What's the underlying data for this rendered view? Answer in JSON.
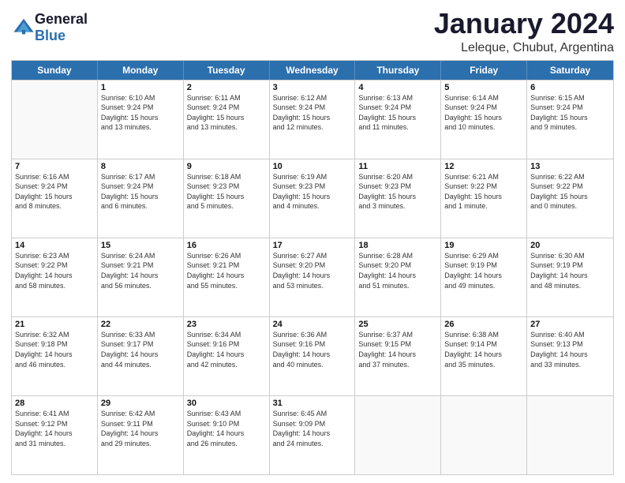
{
  "logo": {
    "text_general": "General",
    "text_blue": "Blue"
  },
  "header": {
    "month": "January 2024",
    "location": "Leleque, Chubut, Argentina"
  },
  "weekdays": [
    "Sunday",
    "Monday",
    "Tuesday",
    "Wednesday",
    "Thursday",
    "Friday",
    "Saturday"
  ],
  "rows": [
    [
      {
        "day": "",
        "lines": [],
        "empty": true
      },
      {
        "day": "1",
        "lines": [
          "Sunrise: 6:10 AM",
          "Sunset: 9:24 PM",
          "Daylight: 15 hours",
          "and 13 minutes."
        ],
        "empty": false
      },
      {
        "day": "2",
        "lines": [
          "Sunrise: 6:11 AM",
          "Sunset: 9:24 PM",
          "Daylight: 15 hours",
          "and 13 minutes."
        ],
        "empty": false
      },
      {
        "day": "3",
        "lines": [
          "Sunrise: 6:12 AM",
          "Sunset: 9:24 PM",
          "Daylight: 15 hours",
          "and 12 minutes."
        ],
        "empty": false
      },
      {
        "day": "4",
        "lines": [
          "Sunrise: 6:13 AM",
          "Sunset: 9:24 PM",
          "Daylight: 15 hours",
          "and 11 minutes."
        ],
        "empty": false
      },
      {
        "day": "5",
        "lines": [
          "Sunrise: 6:14 AM",
          "Sunset: 9:24 PM",
          "Daylight: 15 hours",
          "and 10 minutes."
        ],
        "empty": false
      },
      {
        "day": "6",
        "lines": [
          "Sunrise: 6:15 AM",
          "Sunset: 9:24 PM",
          "Daylight: 15 hours",
          "and 9 minutes."
        ],
        "empty": false
      }
    ],
    [
      {
        "day": "7",
        "lines": [
          "Sunrise: 6:16 AM",
          "Sunset: 9:24 PM",
          "Daylight: 15 hours",
          "and 8 minutes."
        ],
        "empty": false
      },
      {
        "day": "8",
        "lines": [
          "Sunrise: 6:17 AM",
          "Sunset: 9:24 PM",
          "Daylight: 15 hours",
          "and 6 minutes."
        ],
        "empty": false
      },
      {
        "day": "9",
        "lines": [
          "Sunrise: 6:18 AM",
          "Sunset: 9:23 PM",
          "Daylight: 15 hours",
          "and 5 minutes."
        ],
        "empty": false
      },
      {
        "day": "10",
        "lines": [
          "Sunrise: 6:19 AM",
          "Sunset: 9:23 PM",
          "Daylight: 15 hours",
          "and 4 minutes."
        ],
        "empty": false
      },
      {
        "day": "11",
        "lines": [
          "Sunrise: 6:20 AM",
          "Sunset: 9:23 PM",
          "Daylight: 15 hours",
          "and 3 minutes."
        ],
        "empty": false
      },
      {
        "day": "12",
        "lines": [
          "Sunrise: 6:21 AM",
          "Sunset: 9:22 PM",
          "Daylight: 15 hours",
          "and 1 minute."
        ],
        "empty": false
      },
      {
        "day": "13",
        "lines": [
          "Sunrise: 6:22 AM",
          "Sunset: 9:22 PM",
          "Daylight: 15 hours",
          "and 0 minutes."
        ],
        "empty": false
      }
    ],
    [
      {
        "day": "14",
        "lines": [
          "Sunrise: 6:23 AM",
          "Sunset: 9:22 PM",
          "Daylight: 14 hours",
          "and 58 minutes."
        ],
        "empty": false
      },
      {
        "day": "15",
        "lines": [
          "Sunrise: 6:24 AM",
          "Sunset: 9:21 PM",
          "Daylight: 14 hours",
          "and 56 minutes."
        ],
        "empty": false
      },
      {
        "day": "16",
        "lines": [
          "Sunrise: 6:26 AM",
          "Sunset: 9:21 PM",
          "Daylight: 14 hours",
          "and 55 minutes."
        ],
        "empty": false
      },
      {
        "day": "17",
        "lines": [
          "Sunrise: 6:27 AM",
          "Sunset: 9:20 PM",
          "Daylight: 14 hours",
          "and 53 minutes."
        ],
        "empty": false
      },
      {
        "day": "18",
        "lines": [
          "Sunrise: 6:28 AM",
          "Sunset: 9:20 PM",
          "Daylight: 14 hours",
          "and 51 minutes."
        ],
        "empty": false
      },
      {
        "day": "19",
        "lines": [
          "Sunrise: 6:29 AM",
          "Sunset: 9:19 PM",
          "Daylight: 14 hours",
          "and 49 minutes."
        ],
        "empty": false
      },
      {
        "day": "20",
        "lines": [
          "Sunrise: 6:30 AM",
          "Sunset: 9:19 PM",
          "Daylight: 14 hours",
          "and 48 minutes."
        ],
        "empty": false
      }
    ],
    [
      {
        "day": "21",
        "lines": [
          "Sunrise: 6:32 AM",
          "Sunset: 9:18 PM",
          "Daylight: 14 hours",
          "and 46 minutes."
        ],
        "empty": false
      },
      {
        "day": "22",
        "lines": [
          "Sunrise: 6:33 AM",
          "Sunset: 9:17 PM",
          "Daylight: 14 hours",
          "and 44 minutes."
        ],
        "empty": false
      },
      {
        "day": "23",
        "lines": [
          "Sunrise: 6:34 AM",
          "Sunset: 9:16 PM",
          "Daylight: 14 hours",
          "and 42 minutes."
        ],
        "empty": false
      },
      {
        "day": "24",
        "lines": [
          "Sunrise: 6:36 AM",
          "Sunset: 9:16 PM",
          "Daylight: 14 hours",
          "and 40 minutes."
        ],
        "empty": false
      },
      {
        "day": "25",
        "lines": [
          "Sunrise: 6:37 AM",
          "Sunset: 9:15 PM",
          "Daylight: 14 hours",
          "and 37 minutes."
        ],
        "empty": false
      },
      {
        "day": "26",
        "lines": [
          "Sunrise: 6:38 AM",
          "Sunset: 9:14 PM",
          "Daylight: 14 hours",
          "and 35 minutes."
        ],
        "empty": false
      },
      {
        "day": "27",
        "lines": [
          "Sunrise: 6:40 AM",
          "Sunset: 9:13 PM",
          "Daylight: 14 hours",
          "and 33 minutes."
        ],
        "empty": false
      }
    ],
    [
      {
        "day": "28",
        "lines": [
          "Sunrise: 6:41 AM",
          "Sunset: 9:12 PM",
          "Daylight: 14 hours",
          "and 31 minutes."
        ],
        "empty": false
      },
      {
        "day": "29",
        "lines": [
          "Sunrise: 6:42 AM",
          "Sunset: 9:11 PM",
          "Daylight: 14 hours",
          "and 29 minutes."
        ],
        "empty": false
      },
      {
        "day": "30",
        "lines": [
          "Sunrise: 6:43 AM",
          "Sunset: 9:10 PM",
          "Daylight: 14 hours",
          "and 26 minutes."
        ],
        "empty": false
      },
      {
        "day": "31",
        "lines": [
          "Sunrise: 6:45 AM",
          "Sunset: 9:09 PM",
          "Daylight: 14 hours",
          "and 24 minutes."
        ],
        "empty": false
      },
      {
        "day": "",
        "lines": [],
        "empty": true
      },
      {
        "day": "",
        "lines": [],
        "empty": true
      },
      {
        "day": "",
        "lines": [],
        "empty": true
      }
    ]
  ]
}
